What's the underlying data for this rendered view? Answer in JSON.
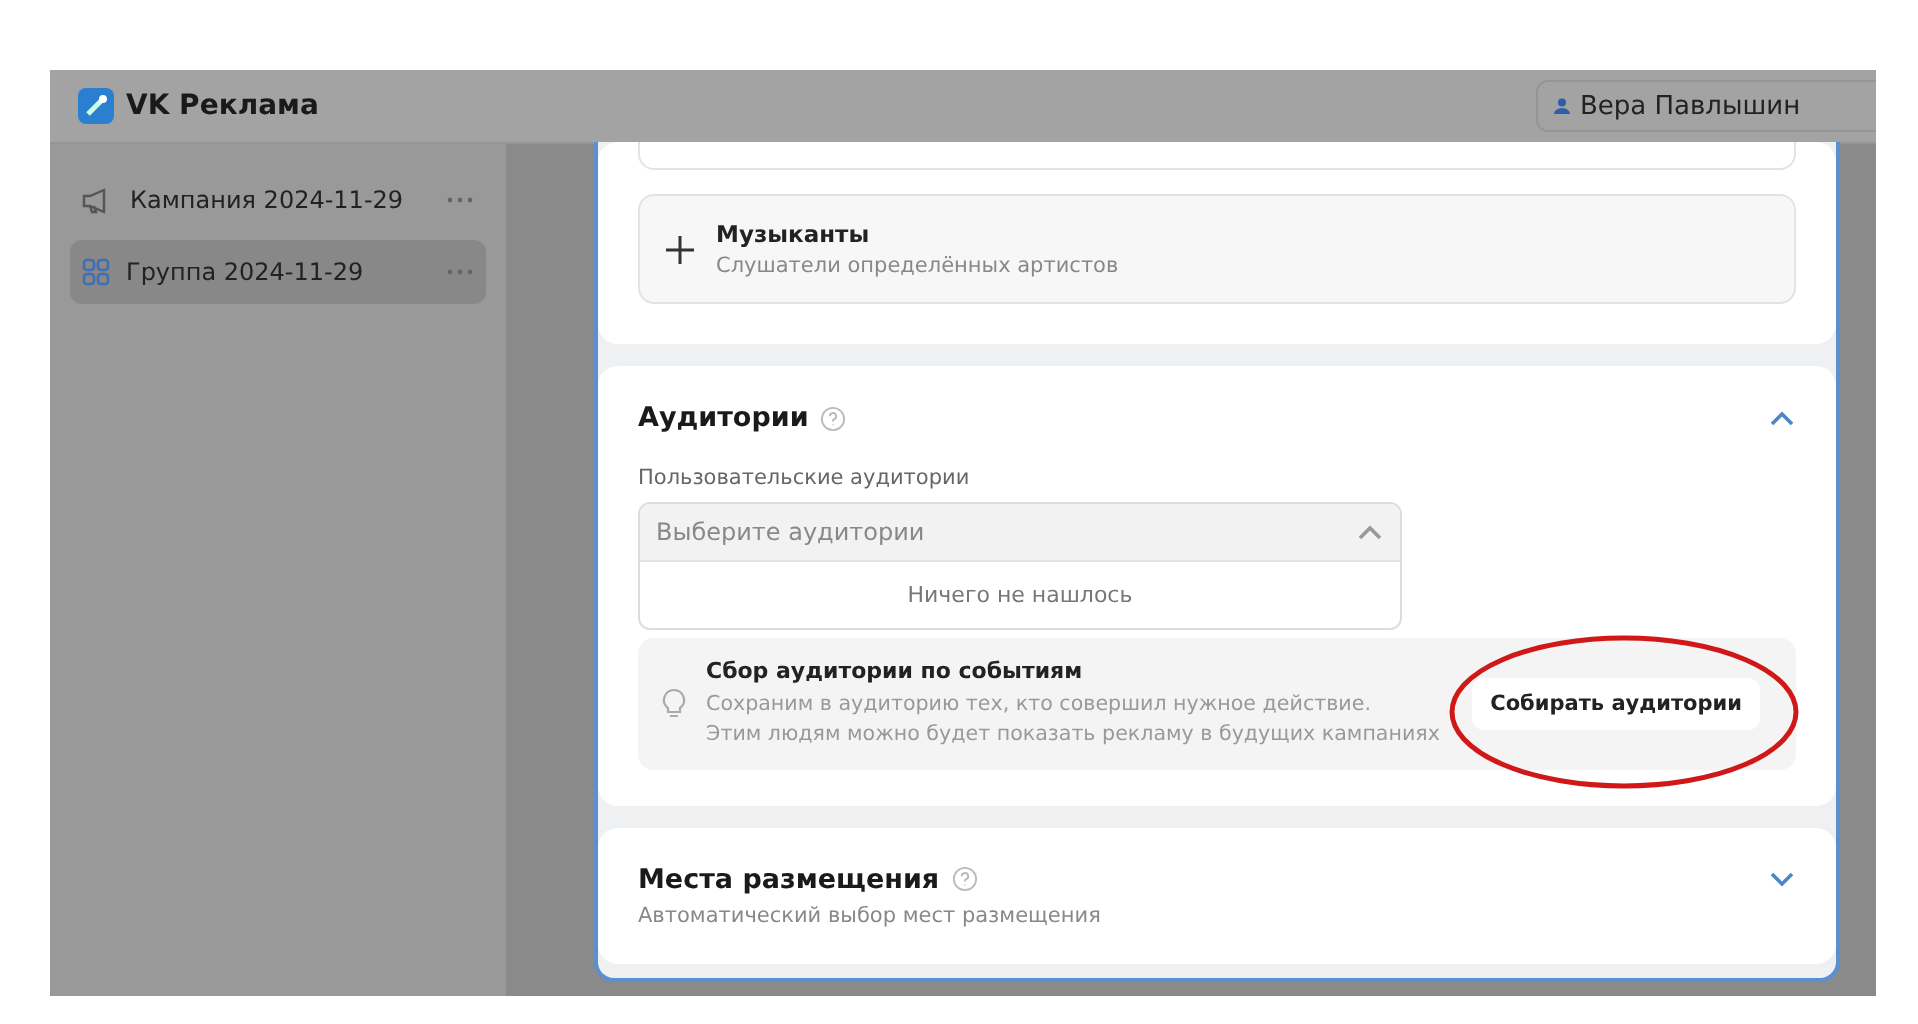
{
  "header": {
    "logo_text": "VK Реклама",
    "user_name": "Вера Павлышин"
  },
  "sidebar": {
    "items": [
      {
        "kind": "campaign",
        "label": "Кампания 2024-11-29",
        "selected": false
      },
      {
        "kind": "group",
        "label": "Группа 2024-11-29",
        "selected": true
      }
    ]
  },
  "interest_option": {
    "title": "Музыканты",
    "subtitle": "Слушатели определённых артистов"
  },
  "audiences": {
    "title": "Аудитории",
    "expanded": true,
    "field_label": "Пользовательские аудитории",
    "placeholder": "Выберите аудитории",
    "dropdown_open": true,
    "empty_text": "Ничего не нашлось",
    "event_box": {
      "title": "Сбор аудитории по событиям",
      "text": "Сохраним в аудиторию тех, кто совершил нужное действие.\nЭтим людям можно будет показать рекламу в будущих кампаниях",
      "button": "Собирать аудитории",
      "highlighted": true
    }
  },
  "placements": {
    "title": "Места размещения",
    "subtitle": "Автоматический выбор мест размещения",
    "expanded": false
  }
}
